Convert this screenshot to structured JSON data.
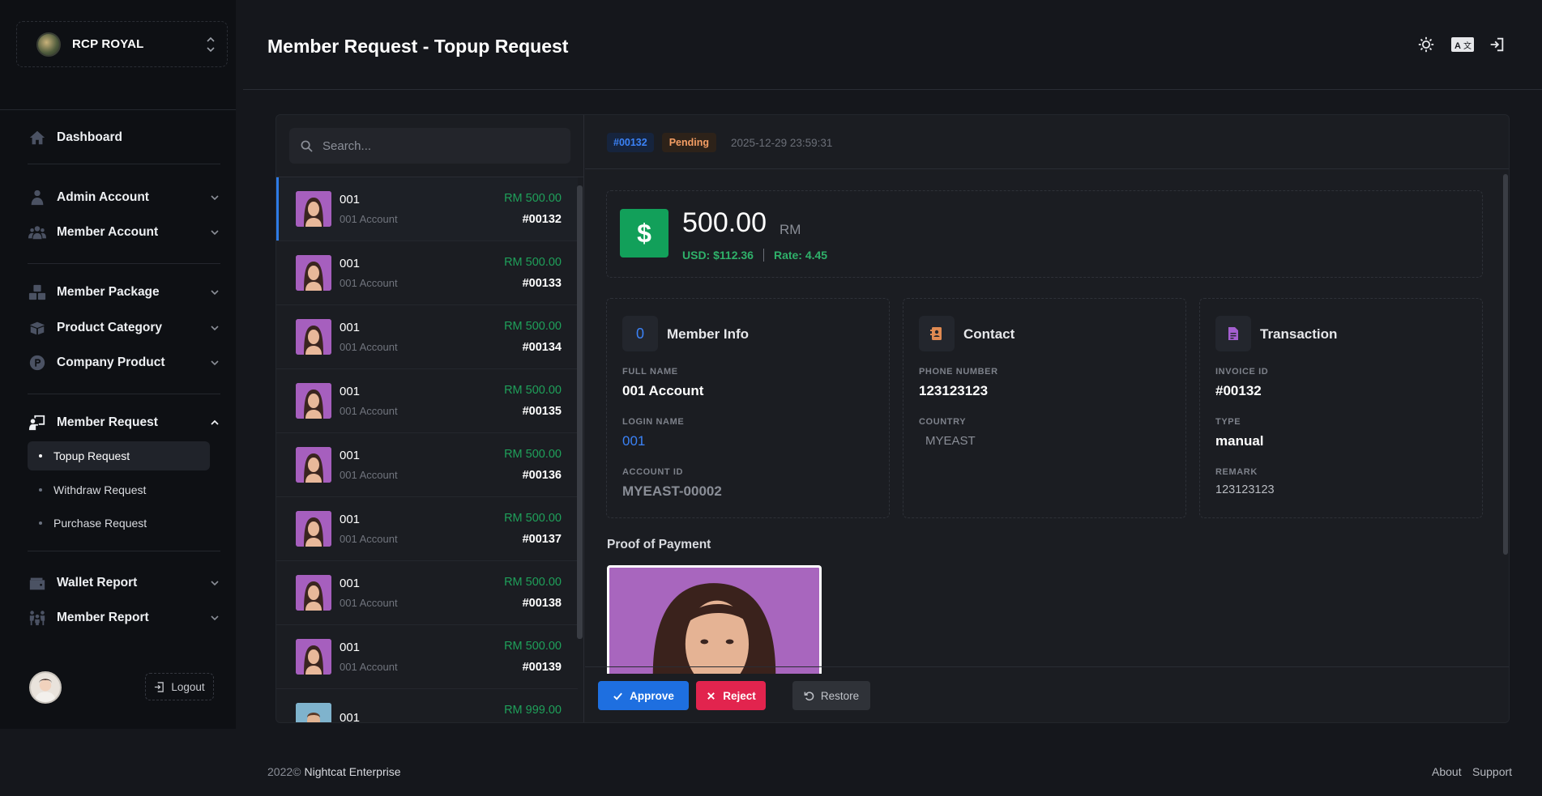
{
  "brand": {
    "name": "RCP ROYAL"
  },
  "sidebar": {
    "items": [
      {
        "label": "Dashboard"
      },
      {
        "label": "Admin Account"
      },
      {
        "label": "Member Account"
      },
      {
        "label": "Member Package"
      },
      {
        "label": "Product Category"
      },
      {
        "label": "Company Product"
      },
      {
        "label": "Member Request"
      },
      {
        "label": "Wallet Report"
      },
      {
        "label": "Member Report"
      }
    ],
    "subitems": [
      {
        "label": "Topup Request"
      },
      {
        "label": "Withdraw Request"
      },
      {
        "label": "Purchase Request"
      }
    ],
    "logout_label": "Logout"
  },
  "header": {
    "title": "Member Request - Topup Request"
  },
  "search": {
    "placeholder": "Search..."
  },
  "requests": [
    {
      "name": "001",
      "account": "001 Account",
      "amount": "RM 500.00",
      "id": "#00132"
    },
    {
      "name": "001",
      "account": "001 Account",
      "amount": "RM 500.00",
      "id": "#00133"
    },
    {
      "name": "001",
      "account": "001 Account",
      "amount": "RM 500.00",
      "id": "#00134"
    },
    {
      "name": "001",
      "account": "001 Account",
      "amount": "RM 500.00",
      "id": "#00135"
    },
    {
      "name": "001",
      "account": "001 Account",
      "amount": "RM 500.00",
      "id": "#00136"
    },
    {
      "name": "001",
      "account": "001 Account",
      "amount": "RM 500.00",
      "id": "#00137"
    },
    {
      "name": "001",
      "account": "001 Account",
      "amount": "RM 500.00",
      "id": "#00138"
    },
    {
      "name": "001",
      "account": "001 Account",
      "amount": "RM 500.00",
      "id": "#00139"
    },
    {
      "name": "001",
      "account": "",
      "amount": "RM 999.00",
      "id": ""
    }
  ],
  "detail": {
    "id_badge": "#00132",
    "status": "Pending",
    "datetime": "2025-12-29 23:59:31",
    "amount": "500.00",
    "currency": "RM",
    "usd": "USD: $112.36",
    "rate": "Rate: 4.45",
    "member_info": {
      "icon_text": "0",
      "title": "Member Info",
      "full_name_label": "FULL NAME",
      "full_name": "001 Account",
      "login_name_label": "LOGIN NAME",
      "login_name": "001",
      "account_id_label": "ACCOUNT ID",
      "account_id": "MYEAST-00002"
    },
    "contact": {
      "title": "Contact",
      "phone_label": "PHONE NUMBER",
      "phone": "123123123",
      "country_label": "COUNTRY",
      "country": "MYEAST"
    },
    "transaction": {
      "title": "Transaction",
      "invoice_label": "INVOICE ID",
      "invoice": "#00132",
      "type_label": "TYPE",
      "type": "manual",
      "remark_label": "REMARK",
      "remark": "123123123"
    },
    "proof_label": "Proof of Payment"
  },
  "actions": {
    "approve": "Approve",
    "reject": "Reject",
    "restore": "Restore"
  },
  "footer": {
    "year": "2022©",
    "company": "Nightcat Enterprise",
    "about": "About",
    "support": "Support"
  },
  "colors": {
    "accent": "#1e6fe0",
    "success": "#12a05a",
    "danger": "#e2244e",
    "pending": "#f59e64"
  }
}
